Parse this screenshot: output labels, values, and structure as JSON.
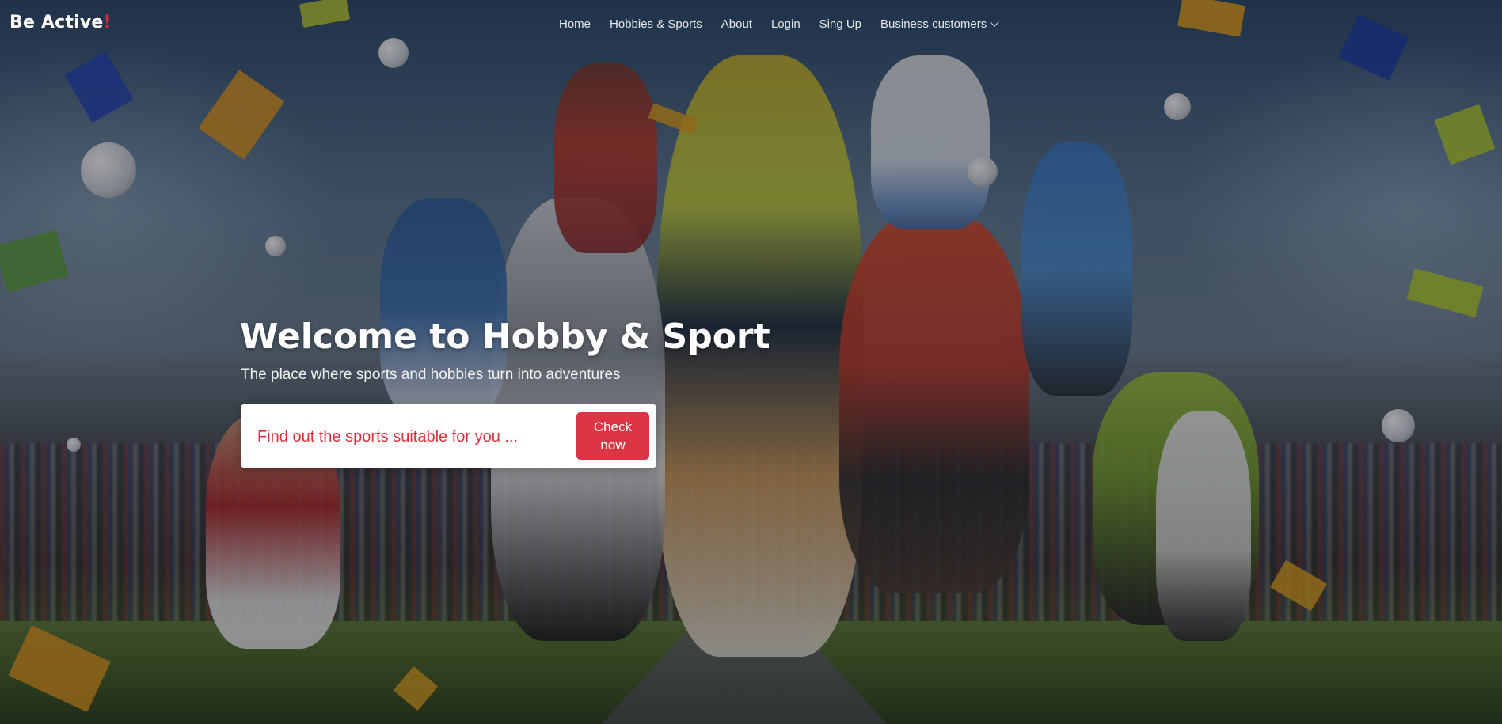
{
  "brand": {
    "name": "Be Active",
    "mark": "!"
  },
  "nav": {
    "items": [
      {
        "label": "Home"
      },
      {
        "label": "Hobbies & Sports"
      },
      {
        "label": "About"
      },
      {
        "label": "Login"
      },
      {
        "label": "Sing Up"
      },
      {
        "label": "Business customers",
        "icon": "chevron-down-icon"
      }
    ]
  },
  "hero": {
    "title": "Welcome to Hobby & Sport",
    "subtitle": "The place where sports and hobbies turn into adventures",
    "search": {
      "placeholder": "Find out the sports suitable for you ...",
      "button_label": "Check now"
    }
  },
  "colors": {
    "accent": "#dc3545",
    "brand_mark": "#e0283a",
    "text_light": "#ffffff"
  }
}
